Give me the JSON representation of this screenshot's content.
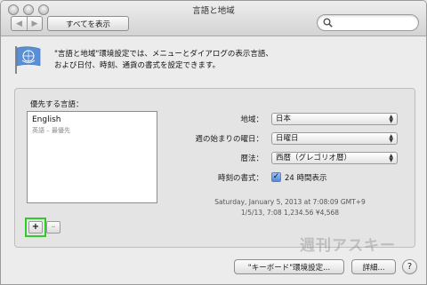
{
  "window": {
    "title": "言語と地域"
  },
  "toolbar": {
    "back_glyph": "◀",
    "forward_glyph": "▶",
    "show_all_label": "すべてを表示",
    "search_value": ""
  },
  "description": {
    "line1": "\"言語と地域\"環境設定では、メニューとダイアログの表示言語、",
    "line2": "および日付、時刻、通貨の書式を設定できます。"
  },
  "preferred_languages": {
    "label": "優先する言語：",
    "items": [
      {
        "name": "English",
        "subtitle": "英語 – 最優先"
      }
    ],
    "add_label": "+",
    "remove_label": "–"
  },
  "settings": {
    "region_label": "地域：",
    "region_value": "日本",
    "week_start_label": "週の始まりの曜日：",
    "week_start_value": "日曜日",
    "calendar_label": "暦法：",
    "calendar_value": "西暦（グレゴリオ暦）",
    "time_format_label": "時刻の書式：",
    "time_format_checkbox_label": "24 時間表示",
    "time_format_checked": true
  },
  "example": {
    "line1": "Saturday, January 5, 2013 at 7:08:09 GMT+9",
    "line2": "1/5/13, 7:08    1,234.56    ¥4,568"
  },
  "buttons": {
    "keyboard_prefs_label": "\"キーボード\"環境設定...",
    "advanced_label": "詳細...",
    "help_label": "?"
  },
  "watermark": {
    "text": "週刊アスキー"
  },
  "colors": {
    "highlight": "#2ecc2e",
    "checkbox_accent": "#4a8ae0"
  }
}
